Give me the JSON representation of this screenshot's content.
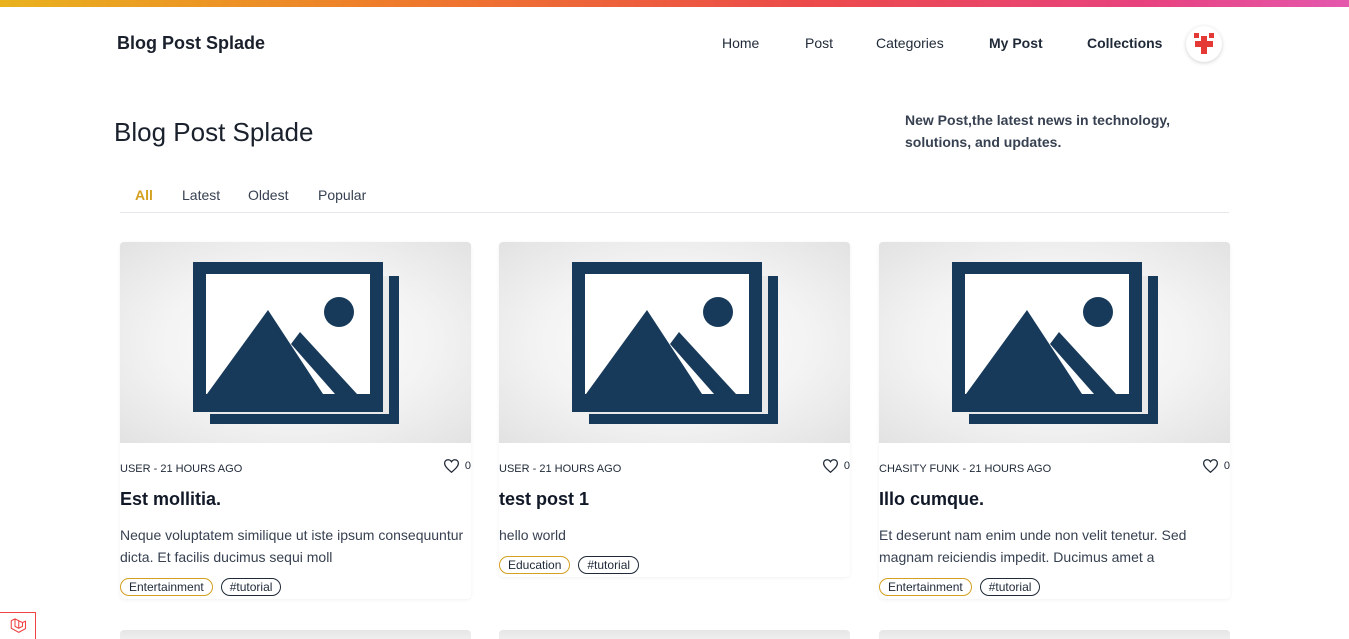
{
  "header": {
    "brand": "Blog Post Splade",
    "nav": {
      "home": "Home",
      "post": "Post",
      "categories": "Categories",
      "my_post": "My Post",
      "collections": "Collections"
    }
  },
  "hero": {
    "title": "Blog Post Splade",
    "description": "New Post,the latest news in technology, solutions, and updates."
  },
  "tabs": [
    "All",
    "Latest",
    "Oldest",
    "Popular"
  ],
  "active_tab": "All",
  "colors": {
    "accent": "#d4a020",
    "image_icon": "#183a5a",
    "laravel_red": "#ef4444"
  },
  "posts": [
    {
      "meta": "USER - 21 HOURS AGO",
      "likes": "0",
      "title": "Est mollitia.",
      "excerpt": "Neque voluptatem similique ut iste ipsum consequuntur dicta. Et facilis ducimus sequi moll",
      "category": "Entertainment",
      "tag": "#tutorial"
    },
    {
      "meta": "USER - 21 HOURS AGO",
      "likes": "0",
      "title": "test post 1",
      "excerpt": "hello world",
      "category": "Education",
      "tag": "#tutorial"
    },
    {
      "meta": "CHASITY FUNK - 21 HOURS AGO",
      "likes": "0",
      "title": "Illo cumque.",
      "excerpt": "Et deserunt nam enim unde non velit tenetur. Sed magnam reiciendis impedit. Ducimus amet a",
      "category": "Entertainment",
      "tag": "#tutorial"
    }
  ]
}
